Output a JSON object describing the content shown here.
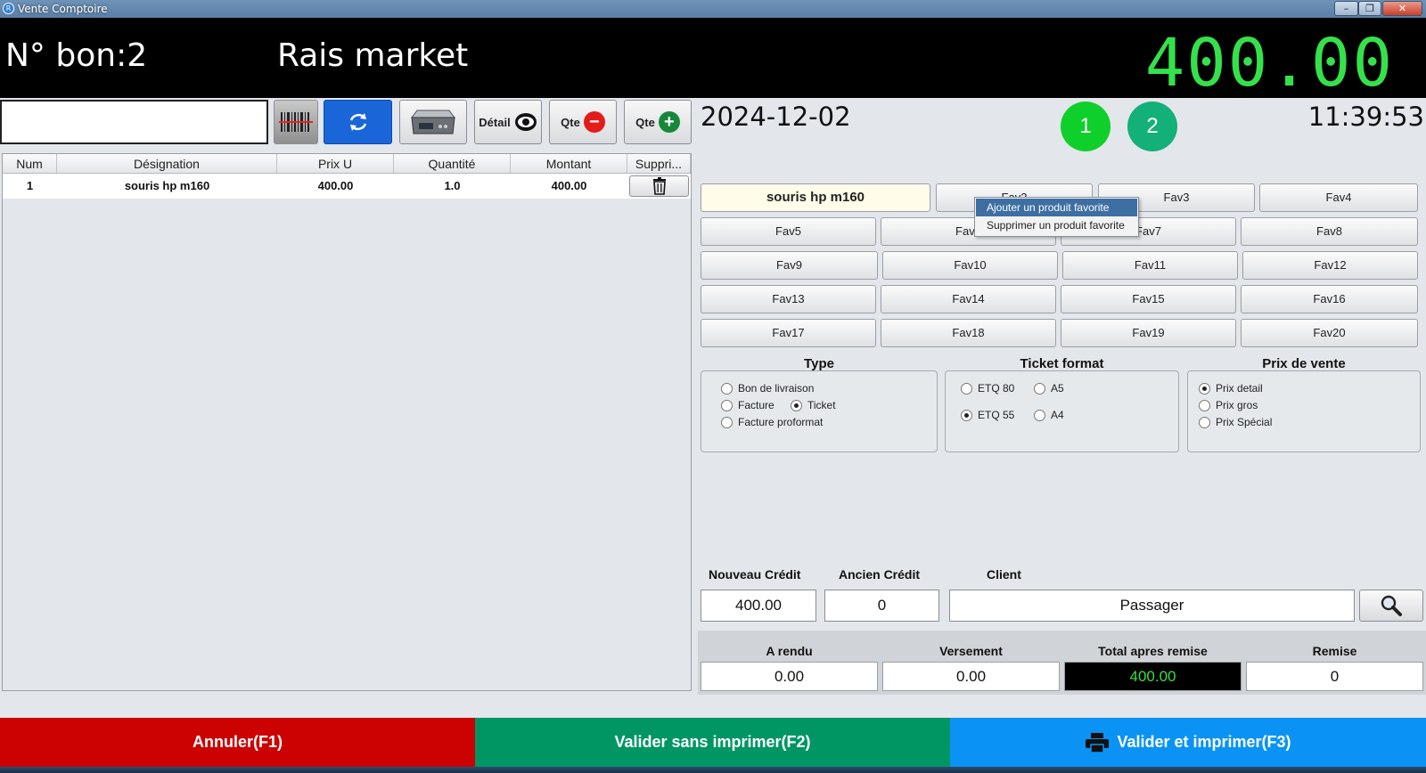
{
  "window": {
    "title": "Vente Comptoire",
    "minimize": "–",
    "maximize": "❐",
    "close": "✕"
  },
  "header": {
    "bon": "N° bon:2",
    "store": "Rais market",
    "total": "400.00"
  },
  "toolbar": {
    "barcode_value": "",
    "detail_label": "Détail",
    "qte_minus_label": "Qte",
    "qte_plus_label": "Qte"
  },
  "table": {
    "columns": [
      "Num",
      "Désignation",
      "Prix U",
      "Quantité",
      "Montant",
      "Suppri..."
    ],
    "rows": [
      {
        "num": "1",
        "designation": "souris hp m160",
        "prix_u": "400.00",
        "quantite": "1.0",
        "montant": "400.00"
      }
    ]
  },
  "info": {
    "date": "2024-12-02",
    "time": "11:39:53",
    "circle1": "1",
    "circle2": "2"
  },
  "favorites": [
    "souris hp m160",
    "Fav2",
    "Fav3",
    "Fav4",
    "Fav5",
    "Fav6",
    "Fav7",
    "Fav8",
    "Fav9",
    "Fav10",
    "Fav11",
    "Fav12",
    "Fav13",
    "Fav14",
    "Fav15",
    "Fav16",
    "Fav17",
    "Fav18",
    "Fav19",
    "Fav20"
  ],
  "context_menu": {
    "add": "Ajouter un produit favorite",
    "remove": "Supprimer un produit favorite"
  },
  "type_group": {
    "title": "Type",
    "options": [
      "Bon de livraison",
      "Facture",
      "Ticket",
      "Facture proformat"
    ],
    "selected": "Ticket"
  },
  "ticket_group": {
    "title": "Ticket format",
    "options": [
      "ETQ 80",
      "A5",
      "ETQ 55",
      "A4"
    ],
    "selected": "ETQ 55"
  },
  "price_group": {
    "title": "Prix de vente",
    "options": [
      "Prix detail",
      "Prix gros",
      "Prix Spécial"
    ],
    "selected": "Prix detail"
  },
  "credit": {
    "nouveau_label": "Nouveau Crédit",
    "nouveau_value": "400.00",
    "ancien_label": "Ancien Crédit",
    "ancien_value": "0",
    "client_label": "Client",
    "client_value": "Passager"
  },
  "totals": {
    "rendu_label": "A rendu",
    "rendu_value": "0.00",
    "versement_label": "Versement",
    "versement_value": "0.00",
    "total_remise_label": "Total apres remise",
    "total_remise_value": "400.00",
    "remise_label": "Remise",
    "remise_value": "0"
  },
  "actions": {
    "cancel": "Annuler(F1)",
    "validate": "Valider sans imprimer(F2)",
    "print": "Valider et imprimer(F3)"
  },
  "colors": {
    "cancel": "#cc0202",
    "validate": "#009664",
    "print": "#0a93f5",
    "total_green": "#35e14a"
  }
}
